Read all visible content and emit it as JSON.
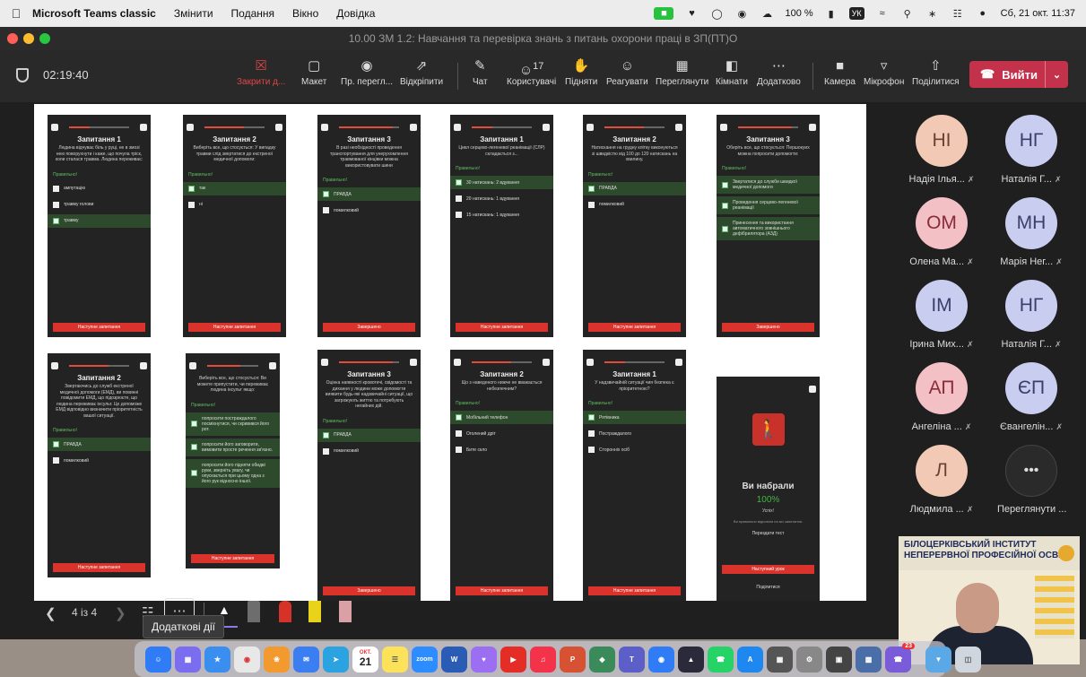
{
  "menubar": {
    "app_name": "Microsoft Teams classic",
    "menus": [
      "Змінити",
      "Подання",
      "Вікно",
      "Довідка"
    ],
    "battery": "100 %",
    "keyboard": "УК",
    "datetime": "Сб, 21 окт.  11:37"
  },
  "window": {
    "title": "10.00 ЗМ 1.2: Навчання та перевірка знань з питань охорони праці в ЗП(ПТ)О"
  },
  "toolbar": {
    "timer": "02:19:40",
    "close_label": "Закрити д...",
    "layout_label": "Макет",
    "preview_label": "Пр. перегл...",
    "undock_label": "Відкріпити",
    "chat_label": "Чат",
    "participants_count": "17",
    "participants_label": "Користувачі",
    "raise_label": "Підняти",
    "react_label": "Реагувати",
    "view_label": "Переглянути",
    "rooms_label": "Кімнати",
    "more_label": "Додатково",
    "camera_label": "Камера",
    "mic_label": "Мікрофон",
    "share_label": "Поділитися",
    "leave_label": "Вийти"
  },
  "slides": [
    {
      "title": "Запитання 1",
      "question": "Людина відчуває біль у руці, не в змозі нею поворухнути і каже, що почула тріск, коли сталася травма. Людина переживає:",
      "feedback": "Правильно!",
      "progress": 0.35,
      "options": [
        {
          "label": "ампутацію",
          "selected": false
        },
        {
          "label": "травму голови",
          "selected": false
        },
        {
          "label": "травму",
          "selected": true
        }
      ],
      "button": "Наступне запитання"
    },
    {
      "title": "Запитання 2",
      "question": "Виберіть все, що стосується: У випадку травми слід звертатися до екстреної медичної допомоги:",
      "feedback": "Правильно!",
      "progress": 0.65,
      "options": [
        {
          "label": "так",
          "selected": true
        },
        {
          "label": "ні",
          "selected": false
        }
      ],
      "button": "Наступне запитання"
    },
    {
      "title": "Запитання 3",
      "question": "В разі необхідності проведення транспортування для унерухомлення травмованої кінцівки можна використовувати шини",
      "feedback": "Правильно!",
      "progress": 0.9,
      "options": [
        {
          "label": "ПРАВДА",
          "selected": true
        },
        {
          "label": "помилковий",
          "selected": false
        }
      ],
      "button": "Завершено"
    },
    {
      "title": "Запитання 1",
      "question": "Цикл серцево-легеневої реанімації (СЛР) складається з...",
      "feedback": "Правильно!",
      "progress": 0.35,
      "options": [
        {
          "label": "30 натискань: 2 вдування",
          "selected": true
        },
        {
          "label": "20 натискань: 1 вдування",
          "selected": false
        },
        {
          "label": "15 натискань: 1 вдування",
          "selected": false
        }
      ],
      "button": "Наступне запитання"
    },
    {
      "title": "Запитання 2",
      "question": "Натискання на грудну клітку виконуються зі швидкістю від 100 до 120 натискань на хвилину.",
      "feedback": "Правильно!",
      "progress": 0.65,
      "options": [
        {
          "label": "ПРАВДА",
          "selected": true
        },
        {
          "label": "помилковий",
          "selected": false
        }
      ],
      "button": "Наступне запитання"
    },
    {
      "title": "Запитання 3",
      "question": "Оберіть все, що стосується: Першокуих можна попросити допомогти:",
      "feedback": "Правильно!",
      "progress": 0.9,
      "options": [
        {
          "label": "Звертатися до служби швидкої медичної допомоги",
          "selected": true
        },
        {
          "label": "Проведення серцево-легеневої реанімації",
          "selected": true
        },
        {
          "label": "Принесення та використання автоматичного зовнішнього дефібрилятора (АЗД)",
          "selected": true
        }
      ],
      "button": "Завершено"
    },
    {
      "title": "Запитання 2",
      "question": "Звертаючись до служб екстреної медичної допомоги (ЕМД), ви повинні повідомити ЕМД, що підозрюєте, що людина переживає інсульт. Це допоможе ЕМД відповідно визначити пріоритетність вашої ситуації.",
      "feedback": "Правильно!",
      "progress": 0.65,
      "options": [
        {
          "label": "ПРАВДА",
          "selected": true
        },
        {
          "label": "помилковий",
          "selected": false
        }
      ],
      "button": "Наступне запитання"
    },
    {
      "title": "",
      "question": "Виберіть все, що стосується: Ви можете припустити, чи переживає людина інсульт якщо:",
      "feedback": "Правильно!",
      "progress": 0.65,
      "options": [
        {
          "label": "попросити постраждалого посміхнутися, чи скривився його рот.",
          "selected": true
        },
        {
          "label": "попросити його заговорити, вимовити просте речення зв'язно.",
          "selected": true
        },
        {
          "label": "попросити його підняти обидві руки, зверніть увагу, чи опускається при цьому одна з його рук відносно іншої.",
          "selected": true
        }
      ],
      "button": "Наступне запитання"
    },
    {
      "title": "Запитання 3",
      "question": "Оцінка наявності кровотечі, свідомості та дихання у людини може допомогти виявити будь-які надзвичайні ситуації, що загрожують життю та потребують негайних дій.",
      "feedback": "Правильно!",
      "progress": 0.9,
      "options": [
        {
          "label": "ПРАВДА",
          "selected": true
        },
        {
          "label": "помилковий",
          "selected": false
        }
      ],
      "button": "Завершено"
    },
    {
      "title": "Запитання 2",
      "question": "Що з наведеного нижче не вважається небезпечним?",
      "feedback": "Правильно!",
      "progress": 0.65,
      "options": [
        {
          "label": "Мобільний телефон",
          "selected": true
        },
        {
          "label": "Оголений дріт",
          "selected": false
        },
        {
          "label": "Бите скло",
          "selected": false
        }
      ],
      "button": "Наступне запитання"
    },
    {
      "title": "Запитання 1",
      "question": "У надзвичайній ситуації чия безпека є пріоритетною?",
      "feedback": "Правильно!",
      "progress": 0.35,
      "options": [
        {
          "label": "Рятівника",
          "selected": true
        },
        {
          "label": "Постраждалого",
          "selected": false
        },
        {
          "label": "Сторонніх осіб",
          "selected": false
        }
      ],
      "button": "Наступне запитання"
    }
  ],
  "result": {
    "icon": "walking-person-icon",
    "title": "Ви набрали",
    "percent": "100%",
    "status": "Успіх!",
    "detail": "Ви правильно відповіли на всі запитання.",
    "retry": "Перездати тест",
    "next_button": "Наступний урок",
    "share": "Поділитися"
  },
  "participants": [
    {
      "initials": "НІ",
      "name": "Надія Ілья...",
      "tone": "light"
    },
    {
      "initials": "НГ",
      "name": "Наталія Г...",
      "tone": "lav"
    },
    {
      "initials": "ОМ",
      "name": "Олена Ма...",
      "tone": "pink"
    },
    {
      "initials": "МН",
      "name": "Марія Нег...",
      "tone": "lav"
    },
    {
      "initials": "ІМ",
      "name": "Ірина Мих...",
      "tone": "lav"
    },
    {
      "initials": "НГ",
      "name": "Наталія Г...",
      "tone": "lav"
    },
    {
      "initials": "АП",
      "name": "Ангеліна ...",
      "tone": "pink"
    },
    {
      "initials": "ЄП",
      "name": "Євангелін...",
      "tone": "lav"
    },
    {
      "initials": "Л",
      "name": "Людмила ...",
      "tone": "light"
    },
    {
      "initials": "•••",
      "name": "Переглянути ...",
      "tone": "more"
    }
  ],
  "video": {
    "banner": "БІЛОЦЕРКІВСЬКИЙ ІНСТИТУТ НЕПЕРЕРВНОЇ ПРОФЕСІЙНОЇ ОСВІТИ"
  },
  "presenter_bar": {
    "page_indicator": "4 із 4",
    "tooltip": "Додаткові дії"
  },
  "dock": {
    "calendar_month": "ОКТ.",
    "calendar_day": "21",
    "zoom_label": "zoom",
    "badge": "23"
  }
}
